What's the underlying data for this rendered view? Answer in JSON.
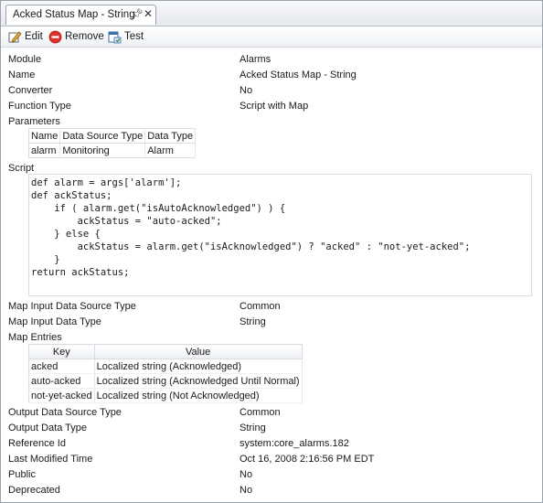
{
  "tab": {
    "title": "Acked Status Map - String"
  },
  "toolbar": {
    "edit_label": "Edit",
    "remove_label": "Remove",
    "test_label": "Test"
  },
  "props_top": [
    {
      "label": "Module",
      "value": "Alarms"
    },
    {
      "label": "Name",
      "value": "Acked Status Map - String"
    },
    {
      "label": "Converter",
      "value": "No"
    },
    {
      "label": "Function Type",
      "value": "Script with Map"
    }
  ],
  "parameters": {
    "label": "Parameters",
    "headers": [
      "Name",
      "Data Source Type",
      "Data Type"
    ],
    "rows": [
      [
        "alarm",
        "Monitoring",
        "Alarm"
      ]
    ]
  },
  "script": {
    "label": "Script",
    "lines": [
      "def alarm = args['alarm'];",
      "def ackStatus;",
      "    if ( alarm.get(\"isAutoAcknowledged\") ) {",
      "        ackStatus = \"auto-acked\";",
      "    } else {",
      "        ackStatus = alarm.get(\"isAcknowledged\") ? \"acked\" : \"not-yet-acked\";",
      "    }",
      "return ackStatus;"
    ]
  },
  "props_mid": [
    {
      "label": "Map Input Data Source Type",
      "value": "Common"
    },
    {
      "label": "Map Input Data Type",
      "value": "String"
    }
  ],
  "map_entries": {
    "label": "Map Entries",
    "headers": [
      "Key",
      "Value"
    ],
    "rows": [
      [
        "acked",
        "Localized string (Acknowledged)"
      ],
      [
        "auto-acked",
        "Localized string (Acknowledged Until Normal)"
      ],
      [
        "not-yet-acked",
        "Localized string (Not Acknowledged)"
      ]
    ]
  },
  "props_bottom": [
    {
      "label": "Output Data Source Type",
      "value": "Common"
    },
    {
      "label": "Output Data Type",
      "value": "String"
    },
    {
      "label": "Reference Id",
      "value": "system:core_alarms.182"
    },
    {
      "label": "Last Modified Time",
      "value": "Oct 16, 2008 2:16:56 PM EDT"
    },
    {
      "label": "Public",
      "value": "No"
    },
    {
      "label": "Deprecated",
      "value": "No"
    }
  ],
  "colors": {
    "remove_icon": "#e0322a",
    "edit_icon": "#c7901f",
    "test_icon": "#3a6fb0"
  },
  "icons": {
    "edit": "pencil-icon",
    "remove": "remove-icon",
    "test": "test-icon",
    "pin": "pin-icon",
    "close": "close-icon"
  }
}
